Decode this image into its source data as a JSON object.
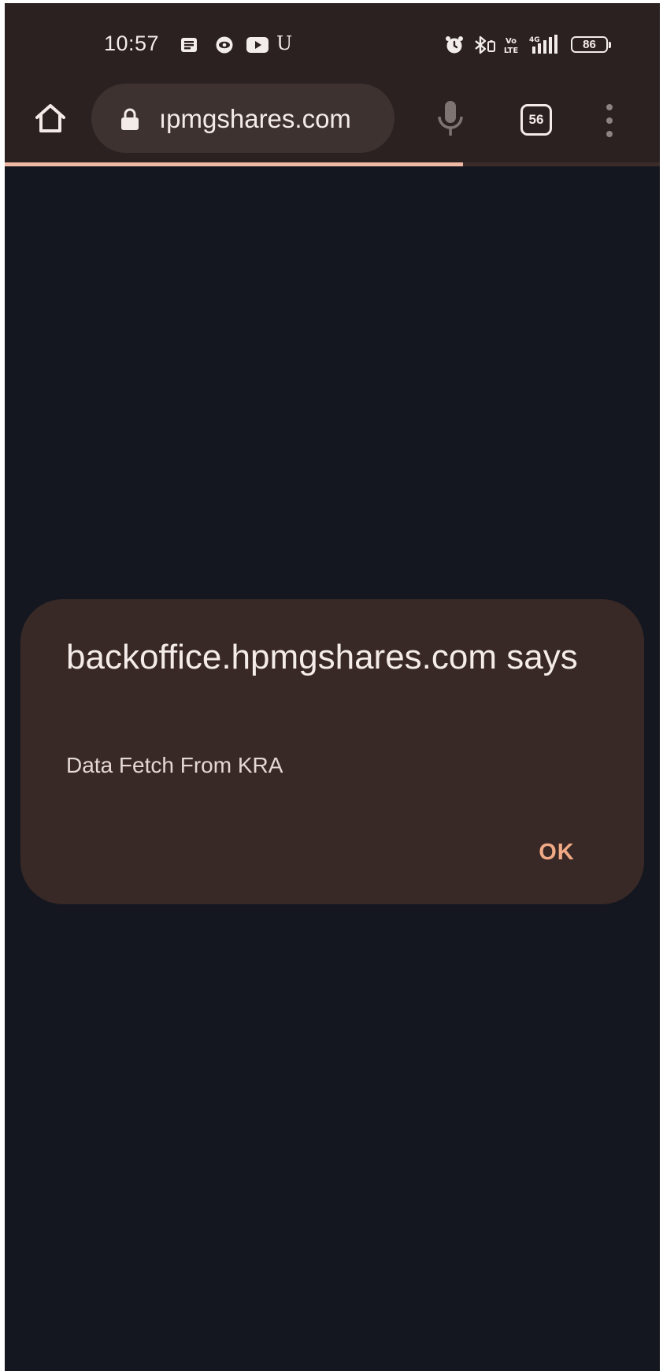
{
  "status_bar": {
    "time": "10:57",
    "carrier_icon_letter": "U",
    "battery_level": "86",
    "icons": [
      "message-icon",
      "eye-icon",
      "youtube-icon",
      "alarm-icon",
      "bluetooth-icon",
      "volte-icon",
      "4g-signal-icon",
      "battery-icon"
    ]
  },
  "toolbar": {
    "url": "ıpmgshares.com",
    "tab_count": "56",
    "page_load_progress": 0.7,
    "icons": [
      "home-icon",
      "lock-icon",
      "mic-icon",
      "tab-switcher-icon",
      "more-menu-icon"
    ]
  },
  "dialog": {
    "title": "backoffice.hpmgshares.com says",
    "message": "Data Fetch From KRA",
    "ok_label": "OK"
  },
  "colors": {
    "page_background": "#141720",
    "toolbar_background": "#2b2120",
    "omnibox_background": "#3e3230",
    "dialog_background": "#382926",
    "accent": "#f1aa86",
    "progress": "#f0b9a5"
  }
}
